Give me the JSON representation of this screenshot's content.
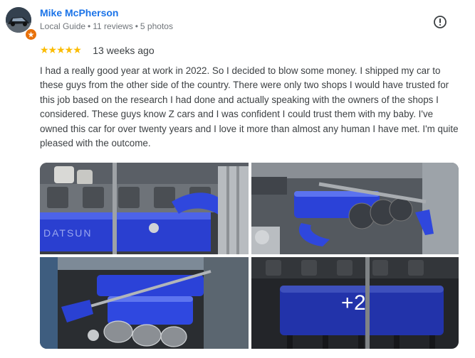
{
  "reviewer": {
    "name": "Mike McPherson",
    "level": "Local Guide",
    "reviews": "11 reviews",
    "photos": "5 photos",
    "separator": "•"
  },
  "review": {
    "stars": "★★★★★",
    "rating": 5,
    "time": "13 weeks ago",
    "text": "I had a really good year at work in 2022. So I decided to blow some money. I shipped my car to these guys from the other side of the country. There were only two shops I would have trusted for this job based on the research I had done and actually speaking with the owners of the shops I considered. These guys know Z cars and I was confident I could trust them with my baby. I've owned this car for over twenty years and I love it more than almost any human I have met. I'm quite pleased with the outcome."
  },
  "gallery": {
    "more_label": "+2"
  },
  "icons": {
    "report": "report-icon",
    "star": "star-icon",
    "local_guide": "local-guide-badge-icon"
  },
  "colors": {
    "name": "#1a73e8",
    "star": "#fbbc04",
    "meta": "#70757a",
    "engine_blue": "#2a3fd0",
    "badge": "#e8710a"
  }
}
